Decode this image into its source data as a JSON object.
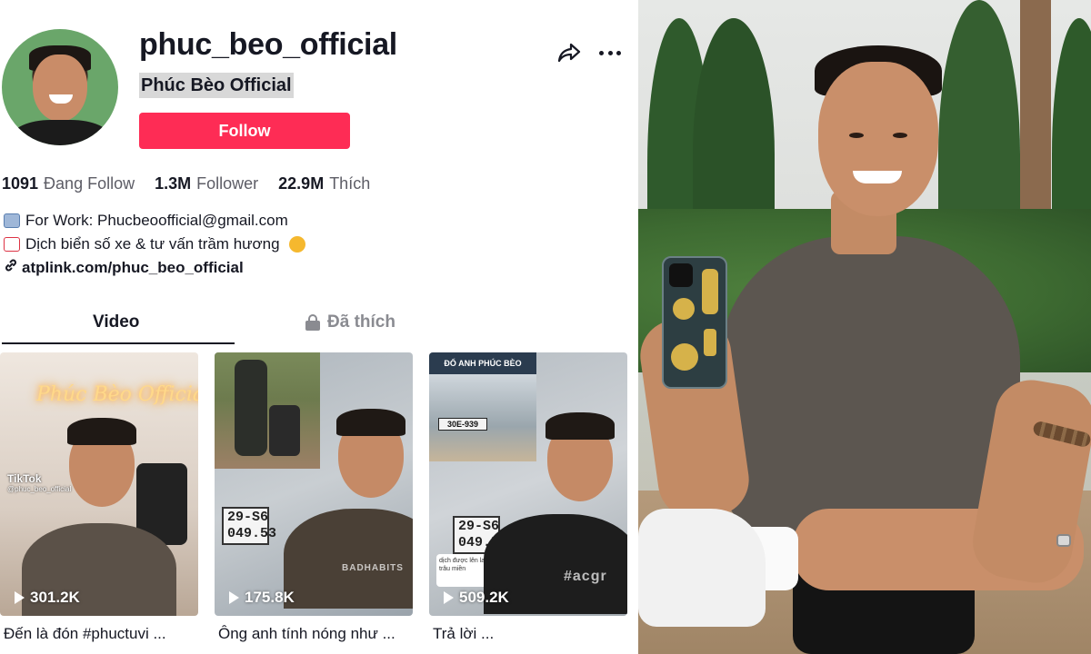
{
  "profile": {
    "username": "phuc_beo_official",
    "nickname": "Phúc Bèo Official",
    "follow_label": "Follow",
    "stats": [
      {
        "value": "1091",
        "label": "Đang Follow"
      },
      {
        "value": "1.3M",
        "label": "Follower"
      },
      {
        "value": "22.9M",
        "label": "Thích"
      }
    ],
    "bio": [
      {
        "icon": "envelope-icon",
        "text": "For Work: Phucbeoofficial@gmail.com"
      },
      {
        "icon": "memo-icon",
        "text": "Dịch biển số xe & tư vấn trầm hương",
        "trailing_icon": "pointing-down-icon"
      }
    ],
    "link": "atplink.com/phuc_beo_official",
    "tabs": [
      {
        "label": "Video",
        "active": true
      },
      {
        "label": "Đã thích",
        "icon": "lock-icon",
        "active": false
      }
    ],
    "videos": [
      {
        "views": "301.2K",
        "caption": "Đến là đón #phuctuvi ...",
        "overlay": "Phúc Bèo Official",
        "watermark": "TikTok",
        "watermark_handle": "@phuc_beo_official"
      },
      {
        "views": "175.8K",
        "caption": "Ông anh tính nóng như ...",
        "plate": "29-S6\n049.53",
        "shirt": "BADHABITS"
      },
      {
        "views": "509.2K",
        "caption": "Trả lời ...",
        "banner": "ĐỔ ANH PHÚC BÈO",
        "car_plate": "30E-939",
        "plate": "29-S6\n049.53",
        "comment": "dịch được lên lai chầu ăn thịt trâu miền",
        "shirt": "#acgr"
      }
    ]
  },
  "colors": {
    "follow_button": "#fe2c55",
    "text_primary": "#161823",
    "text_secondary": "#5d5d66",
    "tab_inactive": "#8a8b91"
  },
  "icons": {
    "share": "share-arrow-icon",
    "more": "more-horizontal-icon",
    "play": "play-icon",
    "link": "link-icon"
  }
}
